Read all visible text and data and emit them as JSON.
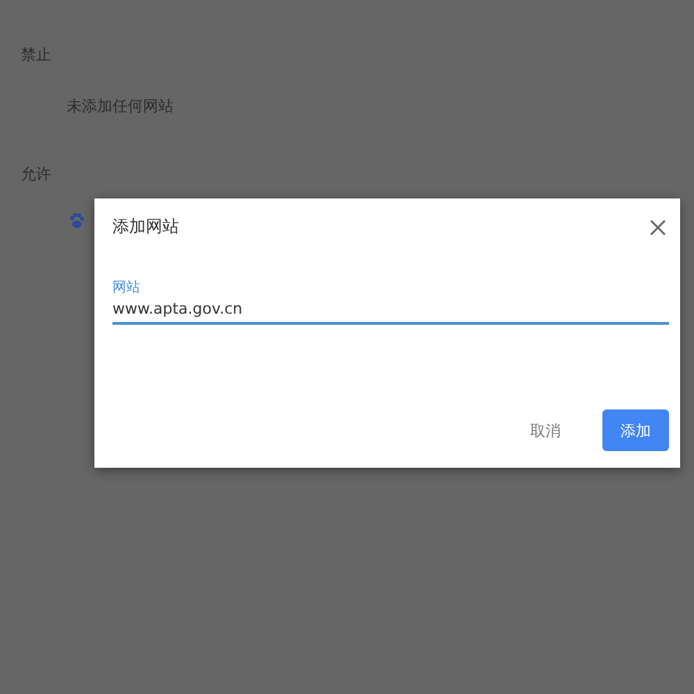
{
  "sections": [
    {
      "heading": "禁止",
      "empty_text": "未添加任何网站"
    },
    {
      "heading": "允许",
      "sites": [
        {
          "kind": "paw"
        }
      ]
    }
  ],
  "dialog": {
    "title": "添加网站",
    "field": {
      "label": "网站",
      "value": "www.apta.gov.cn"
    },
    "buttons": [
      {
        "label": "取消",
        "kind": "text"
      },
      {
        "label": "添加",
        "kind": "primary"
      }
    ]
  }
}
